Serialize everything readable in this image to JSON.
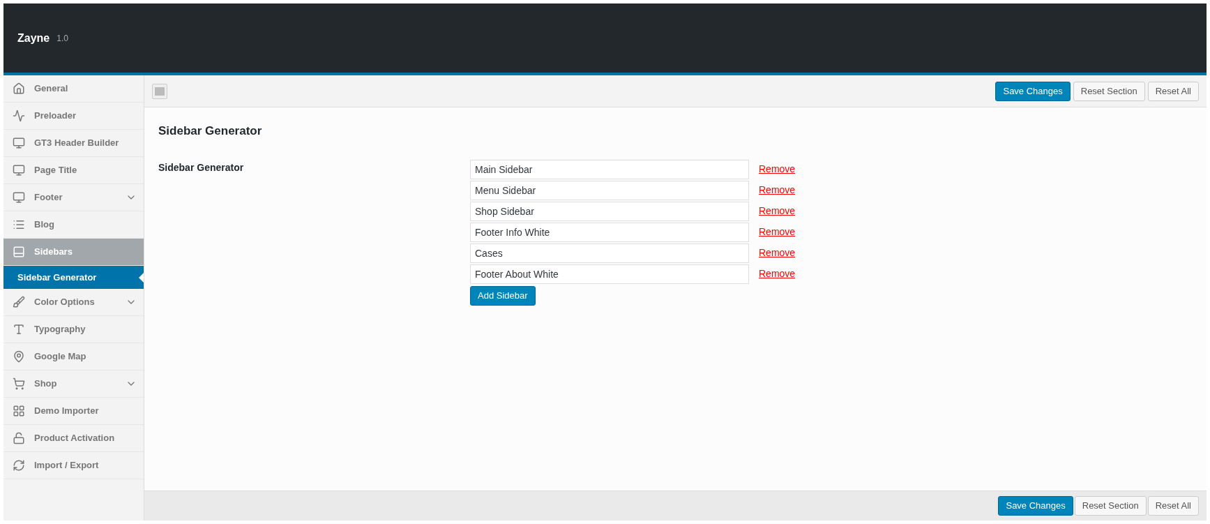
{
  "header": {
    "title": "Zayne",
    "version": "1.0"
  },
  "sidebar": {
    "items": [
      {
        "label": "General",
        "selected": false,
        "has_submenu": false
      },
      {
        "label": "Preloader",
        "selected": false,
        "has_submenu": false
      },
      {
        "label": "GT3 Header Builder",
        "selected": false,
        "has_submenu": false
      },
      {
        "label": "Page Title",
        "selected": false,
        "has_submenu": false
      },
      {
        "label": "Footer",
        "selected": false,
        "has_submenu": true
      },
      {
        "label": "Blog",
        "selected": false,
        "has_submenu": false
      },
      {
        "label": "Sidebars",
        "selected": true,
        "has_submenu": false,
        "children": [
          {
            "label": "Sidebar Generator",
            "selected": true
          }
        ]
      },
      {
        "label": "Color Options",
        "selected": false,
        "has_submenu": true
      },
      {
        "label": "Typography",
        "selected": false,
        "has_submenu": false
      },
      {
        "label": "Google Map",
        "selected": false,
        "has_submenu": false
      },
      {
        "label": "Shop",
        "selected": false,
        "has_submenu": true
      },
      {
        "label": "Demo Importer",
        "selected": false,
        "has_submenu": false
      },
      {
        "label": "Product Activation",
        "selected": false,
        "has_submenu": false
      },
      {
        "label": "Import / Export",
        "selected": false,
        "has_submenu": false
      }
    ]
  },
  "top_buttons": [
    {
      "label": "Save Changes",
      "kind": "primary"
    },
    {
      "label": "Reset Section",
      "kind": "secondary"
    },
    {
      "label": "Reset All",
      "kind": "secondary"
    }
  ],
  "section": {
    "title": "Sidebar Generator",
    "field_label": "Sidebar Generator",
    "sidebars": [
      {
        "value": "Main Sidebar",
        "remove": "Remove"
      },
      {
        "value": "Menu Sidebar",
        "remove": "Remove"
      },
      {
        "value": "Shop Sidebar",
        "remove": "Remove"
      },
      {
        "value": "Footer Info White",
        "remove": "Remove"
      },
      {
        "value": "Cases",
        "remove": "Remove"
      },
      {
        "value": "Footer About White",
        "remove": "Remove"
      }
    ],
    "add_button": "Add Sidebar"
  },
  "bottom_buttons": [
    {
      "label": "Save Changes",
      "kind": "primary"
    },
    {
      "label": "Reset Section",
      "kind": "secondary"
    },
    {
      "label": "Reset All",
      "kind": "secondary"
    }
  ]
}
